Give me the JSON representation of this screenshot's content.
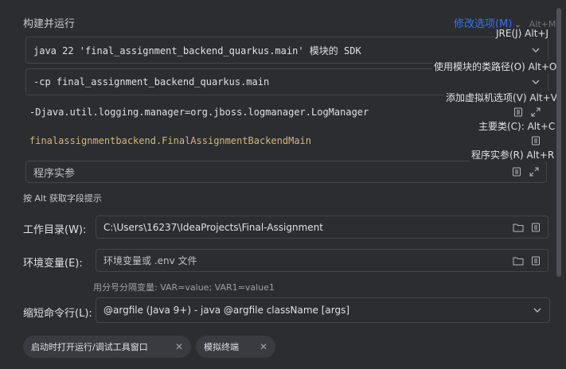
{
  "run_config": {
    "section_title": "构建并运行",
    "modify_options": "修改选项(M)",
    "modify_shortcut": "Alt+M",
    "jre_field": "java 22 'final_assignment_backend_quarkus.main' 模块的 SDK",
    "classpath_field": "-cp final_assignment_backend_quarkus.main",
    "vm_options": "-Djava.util.logging.manager=org.jboss.logmanager.LogManager",
    "main_class": "finalassignmentbackend.FinalAssignmentBackendMain",
    "program_args_placeholder": "程序实参",
    "alt_hint": "按 Alt 获取字段提示"
  },
  "hints": {
    "jre": "JRE(J) Alt+J",
    "module_classpath": "使用模块的类路径(O) Alt+O",
    "vm_options": "添加虚拟机选项(V) Alt+V",
    "main_class": "主要类(C): Alt+C",
    "program_args": "程序实参(R) Alt+R"
  },
  "working_dir": {
    "label": "工作目录(W):",
    "value": "C:\\Users\\16237\\IdeaProjects\\Final-Assignment"
  },
  "env_vars": {
    "label": "环境变量(E):",
    "placeholder": "环境变量或 .env 文件",
    "hint": "用分号分隔变量: VAR=value; VAR1=value1"
  },
  "shorten_cmd": {
    "label": "缩短命令行(L):",
    "value": "@argfile (Java 9+) - java @argfile className [args]"
  },
  "chips": [
    {
      "label": "启动时打开运行/调试工具窗口"
    },
    {
      "label": "模拟终端"
    }
  ]
}
